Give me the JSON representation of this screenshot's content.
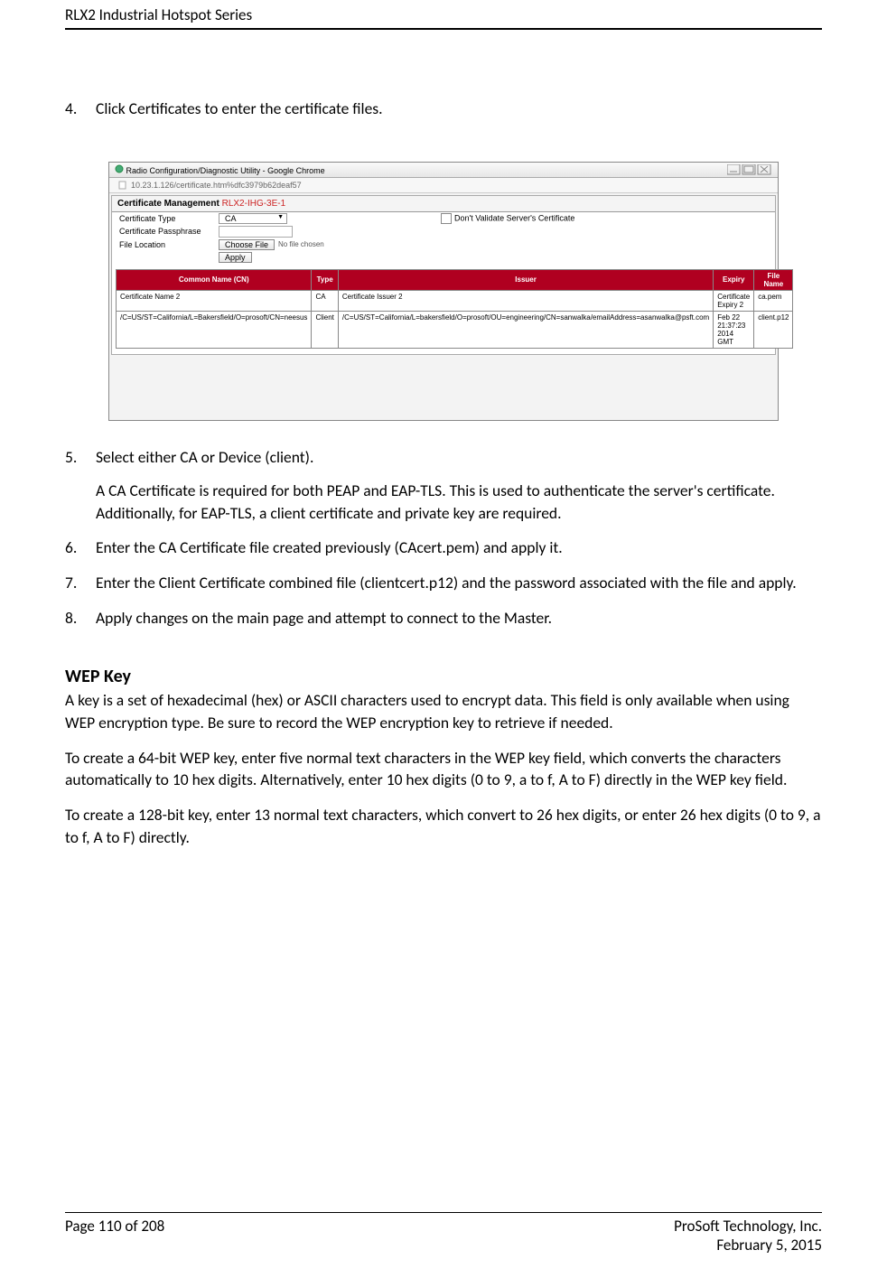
{
  "header": {
    "title": "RLX2 Industrial Hotspot Series"
  },
  "steps": {
    "s4": {
      "num": "4.",
      "text": "Click Certificates to enter the certificate files."
    },
    "s5": {
      "num": "5.",
      "text": "Select either CA or Device (client).",
      "sub": "A CA Certificate is required for both PEAP and EAP-TLS.  This is used to authenticate the server's certificate.  Additionally, for EAP-TLS, a client certificate and private key are required."
    },
    "s6": {
      "num": "6.",
      "text": "Enter the CA Certificate file created previously (CAcert.pem) and apply it."
    },
    "s7": {
      "num": "7.",
      "text": "Enter the Client Certificate combined file (clientcert.p12) and the password associated with the file and apply."
    },
    "s8": {
      "num": "8.",
      "text": "Apply changes on the main page and attempt to connect to the Master."
    }
  },
  "screenshot": {
    "window_title": "Radio Configuration/Diagnostic Utility - Google Chrome",
    "url": "10.23.1.126/certificate.htm%dfc3979b62deaf57",
    "section_title": "Certificate Management",
    "device_label": "RLX2-IHG-3E-1",
    "form": {
      "cert_type_label": "Certificate Type",
      "cert_type_value": "CA",
      "dont_validate_label": "Don't Validate Server's Certificate",
      "passphrase_label": "Certificate Passphrase",
      "file_location_label": "File Location",
      "choose_file_btn": "Choose File",
      "no_file_text": "No file chosen",
      "apply_btn": "Apply"
    },
    "table": {
      "headers": {
        "cn": "Common Name (CN)",
        "type": "Type",
        "issuer": "Issuer",
        "expiry": "Expiry",
        "file": "File Name"
      },
      "rows": [
        {
          "cn": "Certificate Name 2",
          "type": "CA",
          "issuer": "Certificate Issuer 2",
          "expiry": "Certificate Expiry 2",
          "file": "ca.pem"
        },
        {
          "cn": "/C=US/ST=California/L=Bakersfield/O=prosoft/CN=neesus",
          "type": "Client",
          "issuer": "/C=US/ST=California/L=bakersfield/O=prosoft/OU=engineering/CN=sanwalka/emailAddress=asanwalka@psft.com",
          "expiry": "Feb 22 21:37:23 2014 GMT",
          "file": "client.p12"
        }
      ]
    }
  },
  "wep": {
    "heading": "WEP Key",
    "p1": "A key is a set of hexadecimal (hex) or ASCII characters used to encrypt data. This field is only available when using WEP encryption type. Be sure to record the WEP encryption key to retrieve if needed.",
    "p2": "To create a 64-bit WEP key, enter five normal text characters in the WEP key field, which converts the characters automatically to 10 hex digits. Alternatively, enter 10 hex digits (0 to 9, a to f, A to F) directly in the WEP key field.",
    "p3": "To create a 128-bit key, enter 13 normal text characters, which convert to 26 hex digits, or enter 26 hex digits (0 to 9, a to f, A to F) directly."
  },
  "footer": {
    "page": "Page 110 of 208",
    "company": "ProSoft Technology, Inc.",
    "date": "February 5, 2015"
  }
}
